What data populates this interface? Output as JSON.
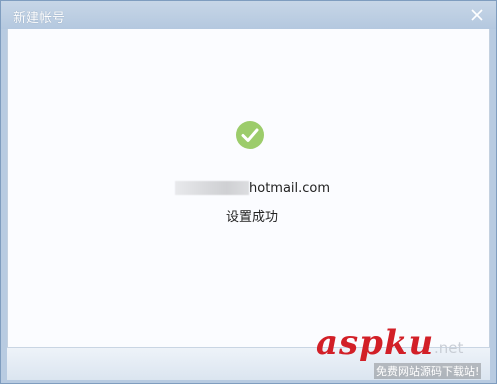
{
  "window": {
    "title": "新建帐号"
  },
  "icons": {
    "close": "close-icon",
    "success": "success-checkmark-icon"
  },
  "colors": {
    "success_green": "#9ccc6b",
    "watermark_red": "#d21f27"
  },
  "content": {
    "email_domain": "hotmail.com",
    "status_message": "设置成功"
  },
  "watermark": {
    "brand": "aspku",
    "suffix": ".net",
    "tagline": "免费网站源码下载站!"
  }
}
